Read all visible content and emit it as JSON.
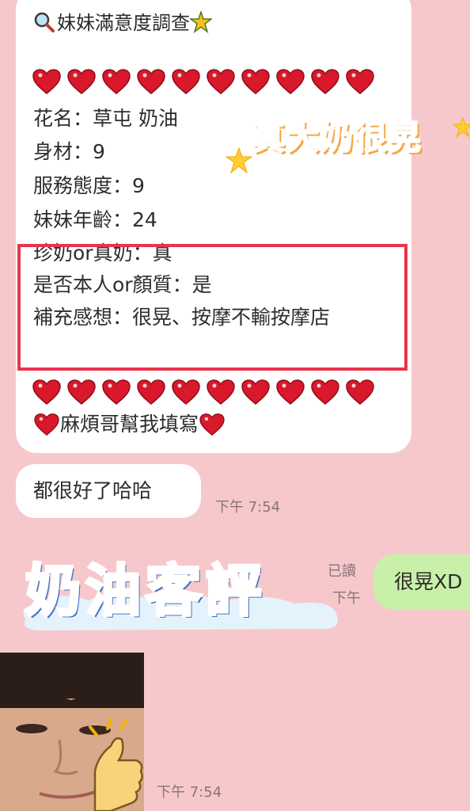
{
  "survey": {
    "title": "妹妹滿意度調查",
    "fields": {
      "flower_name": "花名：草屯 奶油",
      "body": "身材：9",
      "service": "服務態度：9",
      "age": "妹妹年齡：24",
      "real_or_fake": "珍奶or真奶：真",
      "is_real_person": "是否本人or顏質：是",
      "comment": "補充感想：很晃、按摩不輸按摩店"
    },
    "footer": "麻煩哥幫我填寫",
    "heart_count": 10
  },
  "messages": {
    "reply_incoming": "都很好了哈哈",
    "time_incoming_1": "下午 7:54",
    "read_label": "已讀",
    "read_time": "下午 7:54",
    "reply_outgoing": "很晃XD",
    "time_incoming_2": "下午 7:54"
  },
  "stickers": {
    "sticker_top": "真大奶很晃",
    "sticker_review": "奶油客評"
  },
  "colors": {
    "background": "#f6c8cb",
    "incoming_bubble": "#ffffff",
    "outgoing_bubble": "#c9f0a8",
    "highlight_border": "#e8344e",
    "heart": "#d9182b"
  }
}
